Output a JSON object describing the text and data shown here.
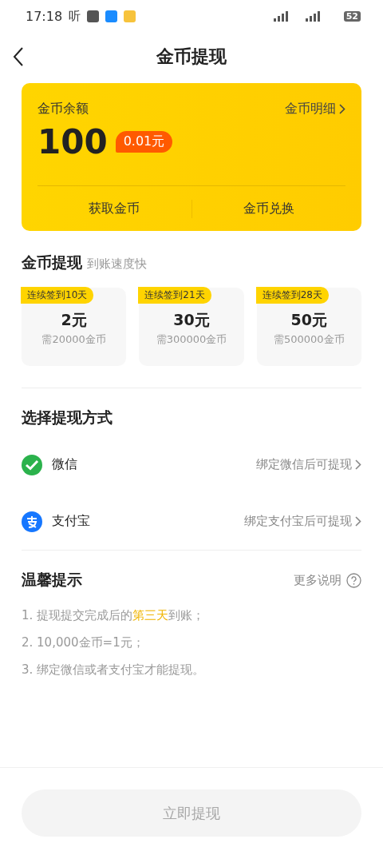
{
  "status_bar": {
    "time": "17:18",
    "app_label": "听",
    "battery": "52"
  },
  "header": {
    "title": "金币提现"
  },
  "balance_card": {
    "label": "金币余额",
    "detail_link": "金币明细",
    "amount": "100",
    "value_badge": "0.01元",
    "actions": [
      "获取金币",
      "金币兑换"
    ]
  },
  "withdraw": {
    "title": "金币提现",
    "subtitle": "到账速度快",
    "options": [
      {
        "tag": "连续签到10天",
        "amount": "2元",
        "cost": "需20000金币"
      },
      {
        "tag": "连续签到21天",
        "amount": "30元",
        "cost": "需300000金币"
      },
      {
        "tag": "连续签到28天",
        "amount": "50元",
        "cost": "需500000金币"
      }
    ]
  },
  "methods": {
    "title": "选择提现方式",
    "items": [
      {
        "kind": "wechat",
        "name": "微信",
        "hint": "绑定微信后可提现"
      },
      {
        "kind": "alipay",
        "name": "支付宝",
        "hint": "绑定支付宝后可提现"
      }
    ]
  },
  "tips": {
    "title": "温馨提示",
    "more": "更多说明",
    "items": [
      "1. 提现提交完成后的**第三天**到账；",
      "2. 10,000金币=1元；",
      "3. 绑定微信或者支付宝才能提现。"
    ]
  },
  "submit": {
    "label": "立即提现",
    "disabled": true
  }
}
